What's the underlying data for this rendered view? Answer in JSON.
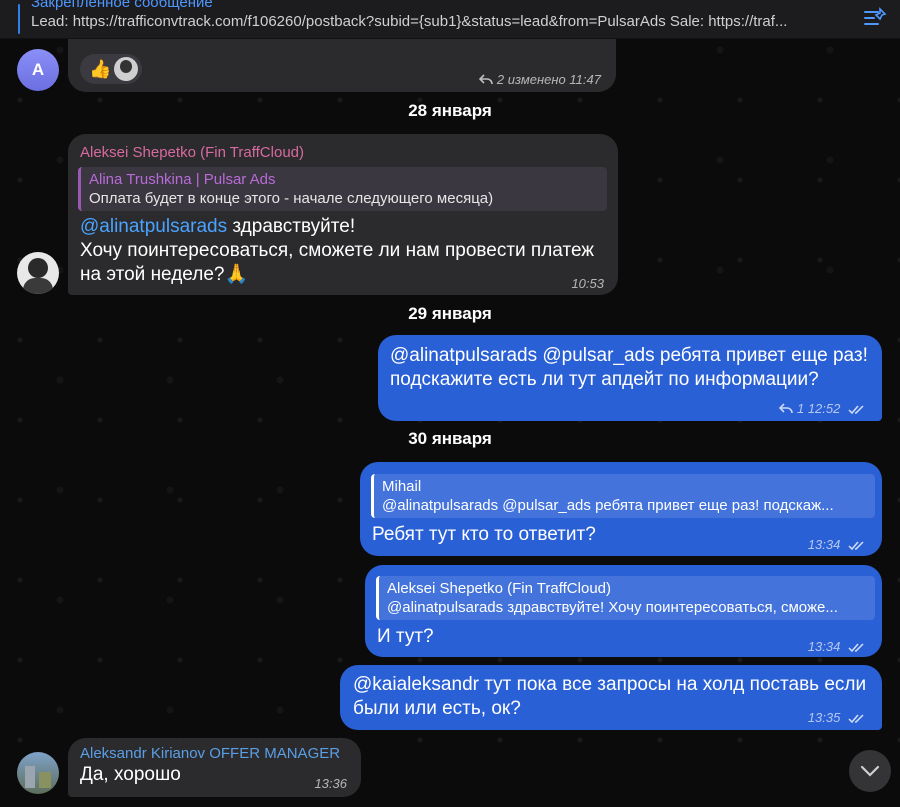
{
  "pinned": {
    "title": "Закрепленное сообщение",
    "text": "Lead: https://trafficonvtrack.com/f106260/postback?subid={sub1}&status=lead&from=PulsarAds Sale: https://traf..."
  },
  "top_partial": {
    "avatar_letter": "A",
    "reaction_emoji": "👍",
    "reply_count": "2",
    "edited": "изменено",
    "time": "11:47"
  },
  "dates": {
    "d28": "28 января",
    "d29": "29 января",
    "d30": "30 января"
  },
  "messages": {
    "m1": {
      "sender": "Aleksei Shepetko (Fin TraffCloud)",
      "reply_name": "Alina Trushkina | Pulsar Ads",
      "reply_text": "Оплата будет в конце этого - начале следующего месяца)",
      "mention": "@alinatpulsarads",
      "text_after_mention": " здравствуйте!",
      "text2": "Хочу поинтересоваться, сможете ли нам провести платеж на этой неделе?🙏",
      "time": "10:53"
    },
    "m2": {
      "text": "@alinatpulsarads @pulsar_ads ребята привет еще раз! подскажите есть ли тут апдейт по информации?",
      "reply_count": "1",
      "time": "12:52"
    },
    "m3": {
      "reply_name": "Mihail",
      "reply_text": "@alinatpulsarads @pulsar_ads ребята привет еще раз! подскаж...",
      "text": "Ребят тут кто то ответит?",
      "time": "13:34"
    },
    "m4": {
      "reply_name": "Aleksei Shepetko (Fin TraffCloud)",
      "reply_text": "@alinatpulsarads здравствуйте! Хочу поинтересоваться, сможе...",
      "text": "И тут?",
      "time": "13:34"
    },
    "m5": {
      "text": "@kaialeksandr тут пока все запросы на холд поставь если были или есть, ок?",
      "time": "13:35"
    },
    "m6": {
      "sender": "Aleksandr Kirianov OFFER MANAGER",
      "text": "Да, хорошо",
      "time": "13:36"
    }
  },
  "icons": {
    "pinned_list": "pinned-list-icon",
    "scroll_down": "chevron-down-icon",
    "reply": "reply-arrow-icon",
    "read": "double-check-icon"
  },
  "colors": {
    "outgoing": "#2a60d6",
    "incoming": "#2b2b2d",
    "link": "#4d97ff",
    "sender_pink": "#d76aa0",
    "sender_purple": "#b86bd8",
    "sender_blue": "#5a9fe6"
  }
}
